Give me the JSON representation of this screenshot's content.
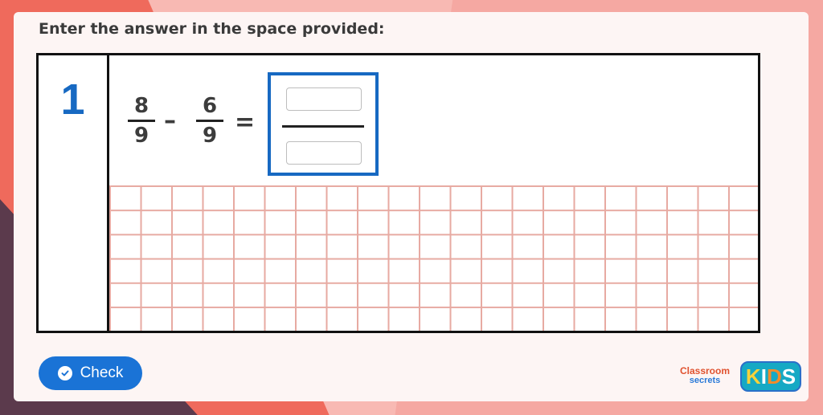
{
  "instruction": "Enter the answer in the space provided:",
  "question": {
    "number": "1",
    "fraction_a": {
      "numerator": "8",
      "denominator": "9"
    },
    "operator": "–",
    "fraction_b": {
      "numerator": "6",
      "denominator": "9"
    },
    "equals": "=",
    "answer": {
      "numerator_value": "",
      "denominator_value": ""
    }
  },
  "check_button": {
    "label": "Check",
    "icon": "check-circle-icon"
  },
  "logo": {
    "classroom_line1": "Classroom",
    "classroom_line2": "secrets",
    "kids_text": [
      "K",
      "I",
      "D",
      "S"
    ],
    "kids_colors": [
      "#f7d23a",
      "#ffffff",
      "#f48b2a",
      "#ffffff"
    ]
  },
  "colors": {
    "accent": "#1769c2",
    "button": "#1a73d6",
    "grid_lines": "#e7aaa2"
  }
}
